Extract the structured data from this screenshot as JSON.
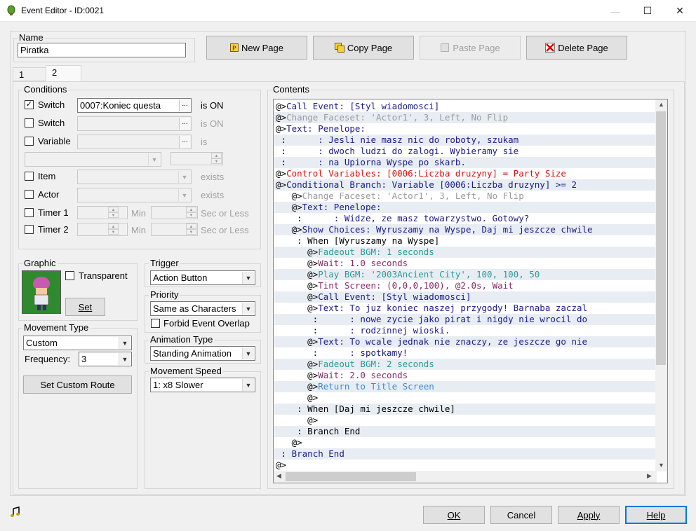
{
  "window": {
    "title": "Event Editor - ID:0021",
    "minimize": "—",
    "maximize": "☐",
    "close": "✕"
  },
  "name": {
    "label": "Name",
    "value": "Piratka"
  },
  "page_buttons": {
    "new": "New Page",
    "copy": "Copy Page",
    "paste": "Paste Page",
    "delete": "Delete Page"
  },
  "tabs": [
    "1",
    "2"
  ],
  "conditions": {
    "label": "Conditions",
    "switch1": {
      "label": "Switch",
      "checked": true,
      "value": "0007:Koniec questa",
      "suffix": "is ON"
    },
    "switch2": {
      "label": "Switch",
      "checked": false,
      "value": "",
      "suffix": "is ON"
    },
    "variable": {
      "label": "Variable",
      "checked": false,
      "value": "",
      "suffix": "is"
    },
    "item": {
      "label": "Item",
      "checked": false,
      "suffix": "exists"
    },
    "actor": {
      "label": "Actor",
      "checked": false,
      "suffix": "exists"
    },
    "timer1": {
      "label": "Timer 1",
      "min": "Min",
      "suffix": "Sec or Less"
    },
    "timer2": {
      "label": "Timer 2",
      "min": "Min",
      "suffix": "Sec or Less"
    }
  },
  "graphic": {
    "label": "Graphic",
    "transparent": "Transparent",
    "set": "Set"
  },
  "movement": {
    "label": "Movement Type",
    "type": "Custom",
    "frequency_label": "Frequency:",
    "frequency": "3",
    "custom_route": "Set Custom Route"
  },
  "trigger": {
    "label": "Trigger",
    "value": "Action Button"
  },
  "priority": {
    "label": "Priority",
    "value": "Same as Characters",
    "forbid": "Forbid Event Overlap"
  },
  "animation": {
    "label": "Animation Type",
    "value": "Standing Animation"
  },
  "speed": {
    "label": "Movement Speed",
    "value": "1: x8 Slower"
  },
  "contents": {
    "label": "Contents",
    "rows": [
      {
        "pfx": "@>",
        "text": "Call Event: [Styl wiadomosci]",
        "color": "c-blue",
        "sel": false
      },
      {
        "pfx": "@>",
        "text": "Change Faceset: 'Actor1', 3, Left, No Flip",
        "color": "c-gray",
        "sel": true
      },
      {
        "pfx": "@>",
        "text": "Text: Penelope:",
        "color": "c-blue",
        "sel": false
      },
      {
        "pfx": " :",
        "text": "      : Jesli nie masz nic do roboty, szukam",
        "color": "c-blue",
        "sel": true
      },
      {
        "pfx": " :",
        "text": "      : dwoch ludzi do zalogi. Wybieramy sie",
        "color": "c-blue",
        "sel": false
      },
      {
        "pfx": " :",
        "text": "      : na Upiorna Wyspe po skarb.",
        "color": "c-blue",
        "sel": true
      },
      {
        "pfx": "@>",
        "text": "Control Variables: [0006:Liczba druzyny] = Party Size",
        "color": "c-red",
        "sel": false
      },
      {
        "pfx": "@>",
        "text": "Conditional Branch: Variable [0006:Liczba druzyny] >= 2",
        "color": "c-blue",
        "sel": true
      },
      {
        "pfx": "   @>",
        "text": "Change Faceset: 'Actor1', 3, Left, No Flip",
        "color": "c-gray",
        "sel": false
      },
      {
        "pfx": "   @>",
        "text": "Text: Penelope:",
        "color": "c-blue",
        "sel": true
      },
      {
        "pfx": "    :",
        "text": "      : Widze, ze masz towarzystwo. Gotowy?",
        "color": "c-blue",
        "sel": false
      },
      {
        "pfx": "   @>",
        "text": "Show Choices: Wyruszamy na Wyspe, Daj mi jeszcze chwile",
        "color": "c-blue",
        "sel": true
      },
      {
        "pfx": "    :",
        "text": " When [Wyruszamy na Wyspe]",
        "color": "c-black",
        "sel": false
      },
      {
        "pfx": "      @>",
        "text": "Fadeout BGM: 1 seconds",
        "color": "c-teal",
        "sel": true
      },
      {
        "pfx": "      @>",
        "text": "Wait: 1.0 seconds",
        "color": "c-purple",
        "sel": false
      },
      {
        "pfx": "      @>",
        "text": "Play BGM: '2003Ancient City', 100, 100, 50",
        "color": "c-teal",
        "sel": true
      },
      {
        "pfx": "      @>",
        "text": "Tint Screen: (0,0,0,100), @2.0s, Wait",
        "color": "c-purple",
        "sel": false
      },
      {
        "pfx": "      @>",
        "text": "Call Event: [Styl wiadomosci]",
        "color": "c-blue",
        "sel": true
      },
      {
        "pfx": "      @>",
        "text": "Text: To juz koniec naszej przygody! Barnaba zaczal",
        "color": "c-blue",
        "sel": false
      },
      {
        "pfx": "       :",
        "text": "      : nowe zycie jako pirat i nigdy nie wrocil do",
        "color": "c-blue",
        "sel": true
      },
      {
        "pfx": "       :",
        "text": "      : rodzinnej wioski.",
        "color": "c-blue",
        "sel": false
      },
      {
        "pfx": "      @>",
        "text": "Text: To wcale jednak nie znaczy, ze jeszcze go nie",
        "color": "c-blue",
        "sel": true
      },
      {
        "pfx": "       :",
        "text": "      : spotkamy!",
        "color": "c-blue",
        "sel": false
      },
      {
        "pfx": "      @>",
        "text": "Fadeout BGM: 2 seconds",
        "color": "c-teal",
        "sel": true
      },
      {
        "pfx": "      @>",
        "text": "Wait: 2.0 seconds",
        "color": "c-purple",
        "sel": false
      },
      {
        "pfx": "      @>",
        "text": "Return to Title Screen",
        "color": "c-lblue",
        "sel": true
      },
      {
        "pfx": "      @>",
        "text": "",
        "color": "c-black",
        "sel": false
      },
      {
        "pfx": "    :",
        "text": " When [Daj mi jeszcze chwile]",
        "color": "c-black",
        "sel": true
      },
      {
        "pfx": "      @>",
        "text": "",
        "color": "c-black",
        "sel": false
      },
      {
        "pfx": "    :",
        "text": " Branch End",
        "color": "c-black",
        "sel": true
      },
      {
        "pfx": "   @>",
        "text": "",
        "color": "c-black",
        "sel": false
      },
      {
        "pfx": " :",
        "text": " Branch End",
        "color": "c-blue",
        "sel": true
      },
      {
        "pfx": "@>",
        "text": "",
        "color": "c-black",
        "sel": false
      }
    ]
  },
  "footer": {
    "ok": "OK",
    "cancel": "Cancel",
    "apply": "Apply",
    "help": "Help"
  },
  "icons": {
    "app": "green-orb-icon",
    "music": "music-note-icon"
  }
}
